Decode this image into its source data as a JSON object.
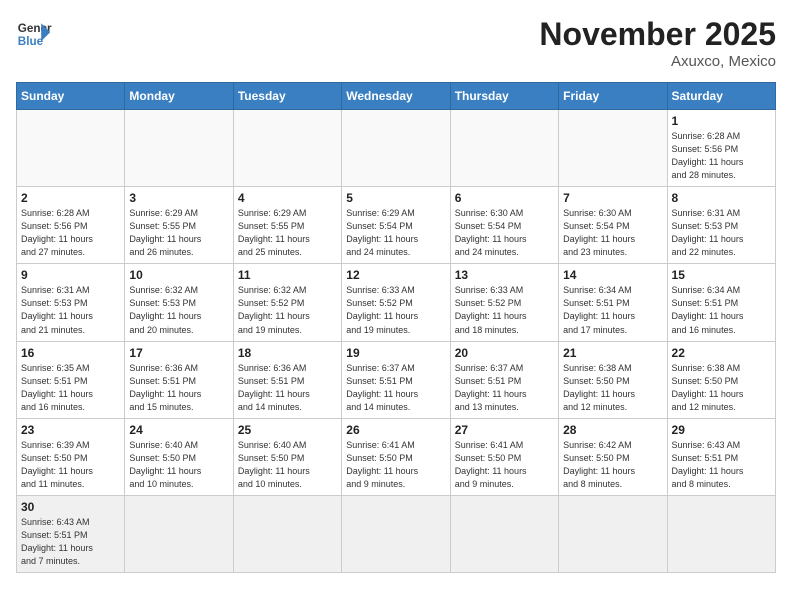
{
  "logo": {
    "line1": "General",
    "line2": "Blue"
  },
  "title": "November 2025",
  "location": "Axuxco, Mexico",
  "weekdays": [
    "Sunday",
    "Monday",
    "Tuesday",
    "Wednesday",
    "Thursday",
    "Friday",
    "Saturday"
  ],
  "days": [
    {
      "num": "",
      "info": ""
    },
    {
      "num": "",
      "info": ""
    },
    {
      "num": "",
      "info": ""
    },
    {
      "num": "",
      "info": ""
    },
    {
      "num": "",
      "info": ""
    },
    {
      "num": "",
      "info": ""
    },
    {
      "num": "1",
      "info": "Sunrise: 6:28 AM\nSunset: 5:56 PM\nDaylight: 11 hours\nand 28 minutes."
    },
    {
      "num": "2",
      "info": "Sunrise: 6:28 AM\nSunset: 5:56 PM\nDaylight: 11 hours\nand 27 minutes."
    },
    {
      "num": "3",
      "info": "Sunrise: 6:29 AM\nSunset: 5:55 PM\nDaylight: 11 hours\nand 26 minutes."
    },
    {
      "num": "4",
      "info": "Sunrise: 6:29 AM\nSunset: 5:55 PM\nDaylight: 11 hours\nand 25 minutes."
    },
    {
      "num": "5",
      "info": "Sunrise: 6:29 AM\nSunset: 5:54 PM\nDaylight: 11 hours\nand 24 minutes."
    },
    {
      "num": "6",
      "info": "Sunrise: 6:30 AM\nSunset: 5:54 PM\nDaylight: 11 hours\nand 24 minutes."
    },
    {
      "num": "7",
      "info": "Sunrise: 6:30 AM\nSunset: 5:54 PM\nDaylight: 11 hours\nand 23 minutes."
    },
    {
      "num": "8",
      "info": "Sunrise: 6:31 AM\nSunset: 5:53 PM\nDaylight: 11 hours\nand 22 minutes."
    },
    {
      "num": "9",
      "info": "Sunrise: 6:31 AM\nSunset: 5:53 PM\nDaylight: 11 hours\nand 21 minutes."
    },
    {
      "num": "10",
      "info": "Sunrise: 6:32 AM\nSunset: 5:53 PM\nDaylight: 11 hours\nand 20 minutes."
    },
    {
      "num": "11",
      "info": "Sunrise: 6:32 AM\nSunset: 5:52 PM\nDaylight: 11 hours\nand 19 minutes."
    },
    {
      "num": "12",
      "info": "Sunrise: 6:33 AM\nSunset: 5:52 PM\nDaylight: 11 hours\nand 19 minutes."
    },
    {
      "num": "13",
      "info": "Sunrise: 6:33 AM\nSunset: 5:52 PM\nDaylight: 11 hours\nand 18 minutes."
    },
    {
      "num": "14",
      "info": "Sunrise: 6:34 AM\nSunset: 5:51 PM\nDaylight: 11 hours\nand 17 minutes."
    },
    {
      "num": "15",
      "info": "Sunrise: 6:34 AM\nSunset: 5:51 PM\nDaylight: 11 hours\nand 16 minutes."
    },
    {
      "num": "16",
      "info": "Sunrise: 6:35 AM\nSunset: 5:51 PM\nDaylight: 11 hours\nand 16 minutes."
    },
    {
      "num": "17",
      "info": "Sunrise: 6:36 AM\nSunset: 5:51 PM\nDaylight: 11 hours\nand 15 minutes."
    },
    {
      "num": "18",
      "info": "Sunrise: 6:36 AM\nSunset: 5:51 PM\nDaylight: 11 hours\nand 14 minutes."
    },
    {
      "num": "19",
      "info": "Sunrise: 6:37 AM\nSunset: 5:51 PM\nDaylight: 11 hours\nand 14 minutes."
    },
    {
      "num": "20",
      "info": "Sunrise: 6:37 AM\nSunset: 5:51 PM\nDaylight: 11 hours\nand 13 minutes."
    },
    {
      "num": "21",
      "info": "Sunrise: 6:38 AM\nSunset: 5:50 PM\nDaylight: 11 hours\nand 12 minutes."
    },
    {
      "num": "22",
      "info": "Sunrise: 6:38 AM\nSunset: 5:50 PM\nDaylight: 11 hours\nand 12 minutes."
    },
    {
      "num": "23",
      "info": "Sunrise: 6:39 AM\nSunset: 5:50 PM\nDaylight: 11 hours\nand 11 minutes."
    },
    {
      "num": "24",
      "info": "Sunrise: 6:40 AM\nSunset: 5:50 PM\nDaylight: 11 hours\nand 10 minutes."
    },
    {
      "num": "25",
      "info": "Sunrise: 6:40 AM\nSunset: 5:50 PM\nDaylight: 11 hours\nand 10 minutes."
    },
    {
      "num": "26",
      "info": "Sunrise: 6:41 AM\nSunset: 5:50 PM\nDaylight: 11 hours\nand 9 minutes."
    },
    {
      "num": "27",
      "info": "Sunrise: 6:41 AM\nSunset: 5:50 PM\nDaylight: 11 hours\nand 9 minutes."
    },
    {
      "num": "28",
      "info": "Sunrise: 6:42 AM\nSunset: 5:50 PM\nDaylight: 11 hours\nand 8 minutes."
    },
    {
      "num": "29",
      "info": "Sunrise: 6:43 AM\nSunset: 5:51 PM\nDaylight: 11 hours\nand 8 minutes."
    },
    {
      "num": "30",
      "info": "Sunrise: 6:43 AM\nSunset: 5:51 PM\nDaylight: 11 hours\nand 7 minutes."
    },
    {
      "num": "",
      "info": ""
    },
    {
      "num": "",
      "info": ""
    },
    {
      "num": "",
      "info": ""
    },
    {
      "num": "",
      "info": ""
    },
    {
      "num": "",
      "info": ""
    },
    {
      "num": "",
      "info": ""
    }
  ]
}
